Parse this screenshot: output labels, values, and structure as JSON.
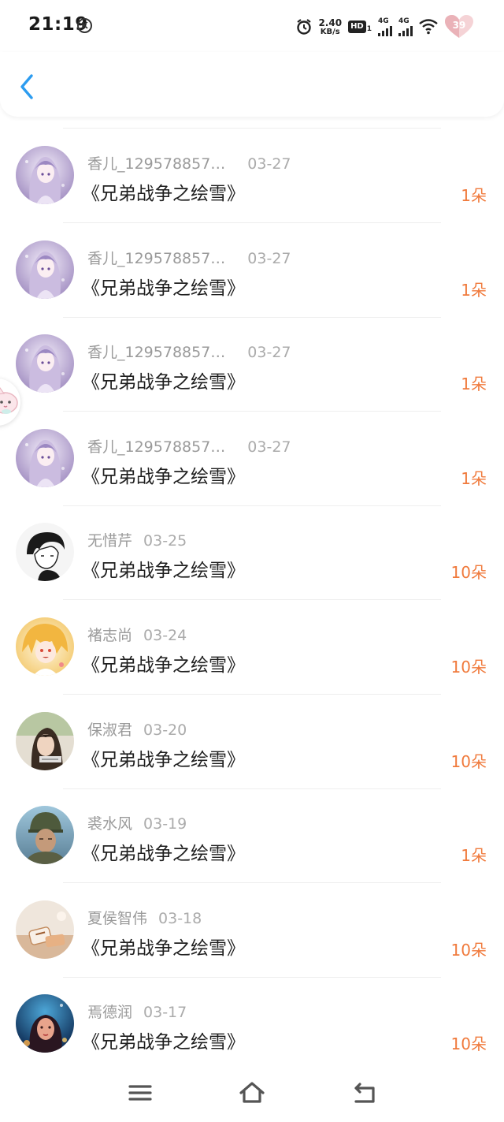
{
  "status_bar": {
    "time": "21:19",
    "k_badge": "K",
    "speed_value": "2.40",
    "speed_unit": "KB/s",
    "hd_label": "HD",
    "hd_sub": "1",
    "signal1_label": "4G",
    "signal2_label": "4G",
    "battery_level": "39"
  },
  "colors": {
    "accent_blue": "#2c9cf0",
    "flower_orange": "#f07a3c"
  },
  "list": {
    "items": [
      {
        "name": "香儿_129578857…",
        "date": "03-27",
        "title": "《兄弟战争之绘雪》",
        "flowers": "1朵",
        "avatar": "anime-lavender"
      },
      {
        "name": "香儿_129578857…",
        "date": "03-27",
        "title": "《兄弟战争之绘雪》",
        "flowers": "1朵",
        "avatar": "anime-lavender"
      },
      {
        "name": "香儿_129578857…",
        "date": "03-27",
        "title": "《兄弟战争之绘雪》",
        "flowers": "1朵",
        "avatar": "anime-lavender"
      },
      {
        "name": "香儿_129578857…",
        "date": "03-27",
        "title": "《兄弟战争之绘雪》",
        "flowers": "1朵",
        "avatar": "anime-lavender"
      },
      {
        "name": "无惜芹",
        "date": "03-25",
        "title": "《兄弟战争之绘雪》",
        "flowers": "10朵",
        "avatar": "sketch-boy"
      },
      {
        "name": "褚志尚",
        "date": "03-24",
        "title": "《兄弟战争之绘雪》",
        "flowers": "10朵",
        "avatar": "anime-blonde"
      },
      {
        "name": "保淑君",
        "date": "03-20",
        "title": "《兄弟战争之绘雪》",
        "flowers": "10朵",
        "avatar": "photo-girl"
      },
      {
        "name": "裘水风",
        "date": "03-19",
        "title": "《兄弟战争之绘雪》",
        "flowers": "1朵",
        "avatar": "photo-soldier"
      },
      {
        "name": "夏侯智伟",
        "date": "03-18",
        "title": "《兄弟战争之绘雪》",
        "flowers": "10朵",
        "avatar": "photo-bottles"
      },
      {
        "name": "焉德润",
        "date": "03-17",
        "title": "《兄弟战争之绘雪》",
        "flowers": "10朵",
        "avatar": "photo-night-girl"
      }
    ]
  },
  "nav": {
    "menu_icon": "menu-icon",
    "home_icon": "home-icon",
    "back_icon": "return-icon"
  }
}
